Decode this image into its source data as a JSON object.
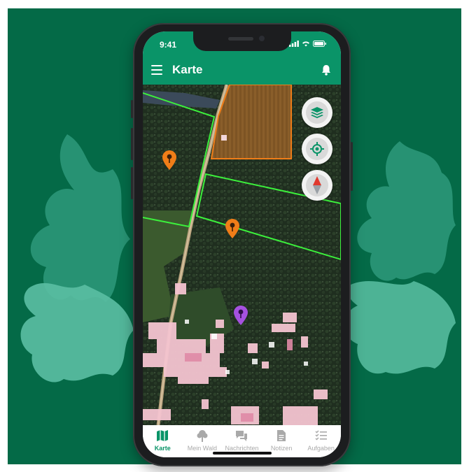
{
  "status_bar": {
    "time": "9:41"
  },
  "app_bar": {
    "title": "Karte"
  },
  "map_controls": {
    "layers_icon": "layers-icon",
    "locate_icon": "locate-icon",
    "compass_icon": "compass-icon"
  },
  "add_pin_button": {
    "icon": "add-marker-icon"
  },
  "tabs": [
    {
      "label": "Karte",
      "icon": "map-icon",
      "active": true
    },
    {
      "label": "Mein Wald",
      "icon": "tree-icon",
      "active": false
    },
    {
      "label": "Nachrichten",
      "icon": "chat-icon",
      "active": false
    },
    {
      "label": "Notizen",
      "icon": "note-icon",
      "active": false
    },
    {
      "label": "Aufgaben",
      "icon": "checklist-icon",
      "active": false
    }
  ],
  "colors": {
    "brand_green": "#0a9468",
    "background_green": "#046a47",
    "leaf_light": "#5bbfa3",
    "pin_orange": "#f07d18",
    "pin_purple": "#a651e0",
    "plot_outline_green": "#3cf03c",
    "plot_outline_orange": "#f07d18"
  }
}
